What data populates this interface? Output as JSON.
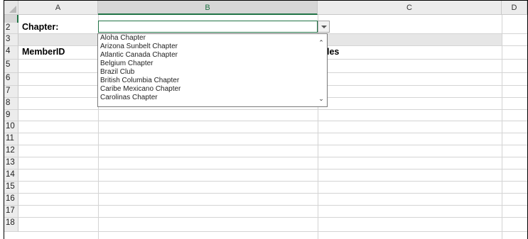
{
  "columns": [
    "A",
    "B",
    "C",
    "D"
  ],
  "rows": [
    "1",
    "2",
    "3",
    "4",
    "5",
    "6",
    "7",
    "8",
    "9",
    "10",
    "11",
    "12",
    "13",
    "14",
    "15",
    "16",
    "17",
    "18"
  ],
  "cells": {
    "a1": "Chapter:",
    "a3": "MemberID",
    "c3_partial": "les"
  },
  "dropdown": {
    "items": [
      "Aloha Chapter",
      "Arizona Sunbelt Chapter",
      "Atlantic Canada Chapter",
      "Belgium Chapter",
      "Brazil Club",
      "British Columbia Chapter",
      "Caribe Mexicano Chapter",
      "Carolinas Chapter"
    ]
  },
  "colors": {
    "selection": "#217346",
    "header_bg": "#ececec",
    "gridline": "#d4d4d4"
  },
  "icons": {
    "dropdown_arrow": "chevron-down-icon",
    "scroll_up": "chevron-up-icon",
    "scroll_down": "chevron-down-icon"
  }
}
